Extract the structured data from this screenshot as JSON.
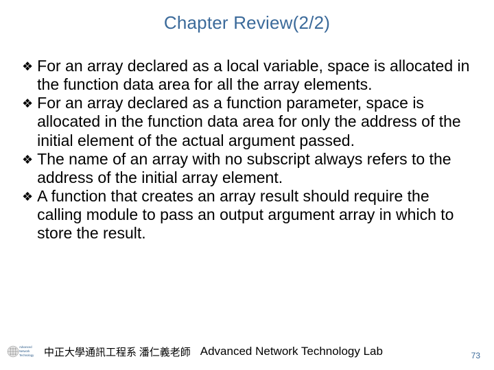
{
  "title": "Chapter Review(2/2)",
  "bullets": [
    "For an array declared as a local variable, space is allocated in the function data area for all the array elements.",
    "For an array declared as a function parameter, space is allocated in the function data area for only the address of the initial element of the actual argument passed.",
    "The name of an array with no subscript always refers to the address of the initial array element.",
    "A function that creates an array result should require the calling module to pass an output argument array in which to store the result."
  ],
  "footer": {
    "cn_text": "中正大學通訊工程系 潘仁義老師",
    "lab_text": "Advanced Network Technology Lab",
    "logo_lines": [
      "Advanced",
      "Network",
      "Technology"
    ]
  },
  "page_number": "73"
}
